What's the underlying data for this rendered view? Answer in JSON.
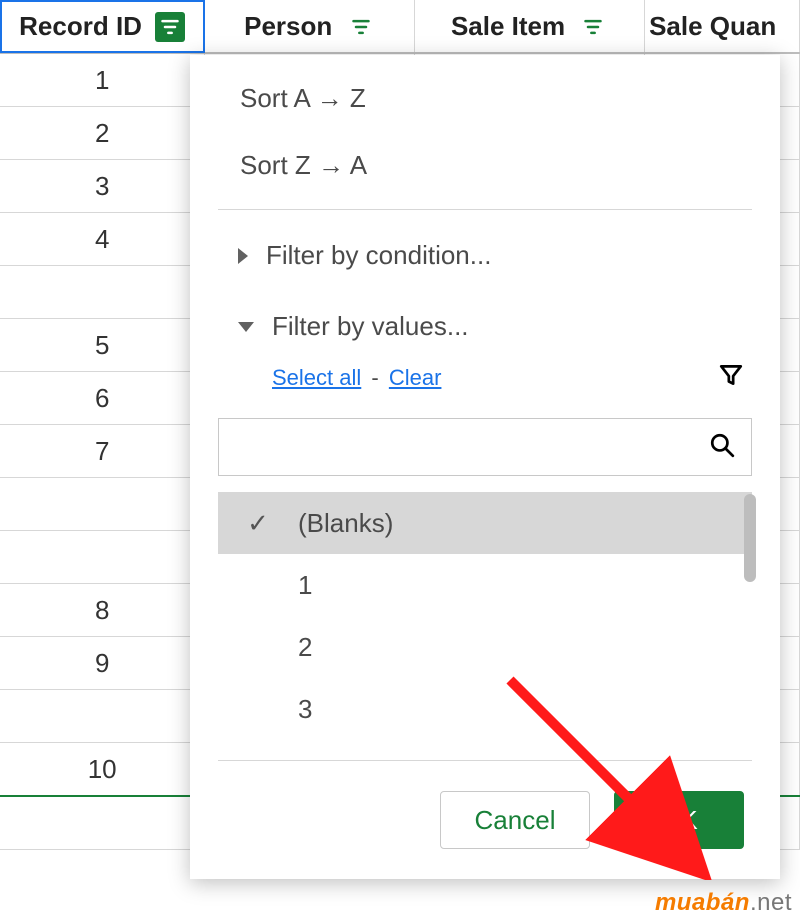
{
  "columns": [
    {
      "label": "Record ID",
      "active_filter": true
    },
    {
      "label": "Person",
      "active_filter": false
    },
    {
      "label": "Sale Item",
      "active_filter": false
    },
    {
      "label": "Sale Quan",
      "active_filter": false
    }
  ],
  "rows": [
    "1",
    "2",
    "3",
    "4",
    "",
    "5",
    "6",
    "7",
    "",
    "",
    "8",
    "9",
    "",
    "10",
    ""
  ],
  "popup": {
    "sort_az": "Sort A → Z",
    "sort_za": "Sort Z → A",
    "filter_condition": "Filter by condition...",
    "filter_values": "Filter by values...",
    "select_all": "Select all",
    "clear": "Clear",
    "search_placeholder": "",
    "values": [
      {
        "label": "(Blanks)",
        "selected": true
      },
      {
        "label": "1",
        "selected": false
      },
      {
        "label": "2",
        "selected": false
      },
      {
        "label": "3",
        "selected": false
      }
    ],
    "cancel": "Cancel",
    "ok": "OK"
  },
  "watermark": {
    "brand": "muabán",
    "suffix": ".net"
  }
}
